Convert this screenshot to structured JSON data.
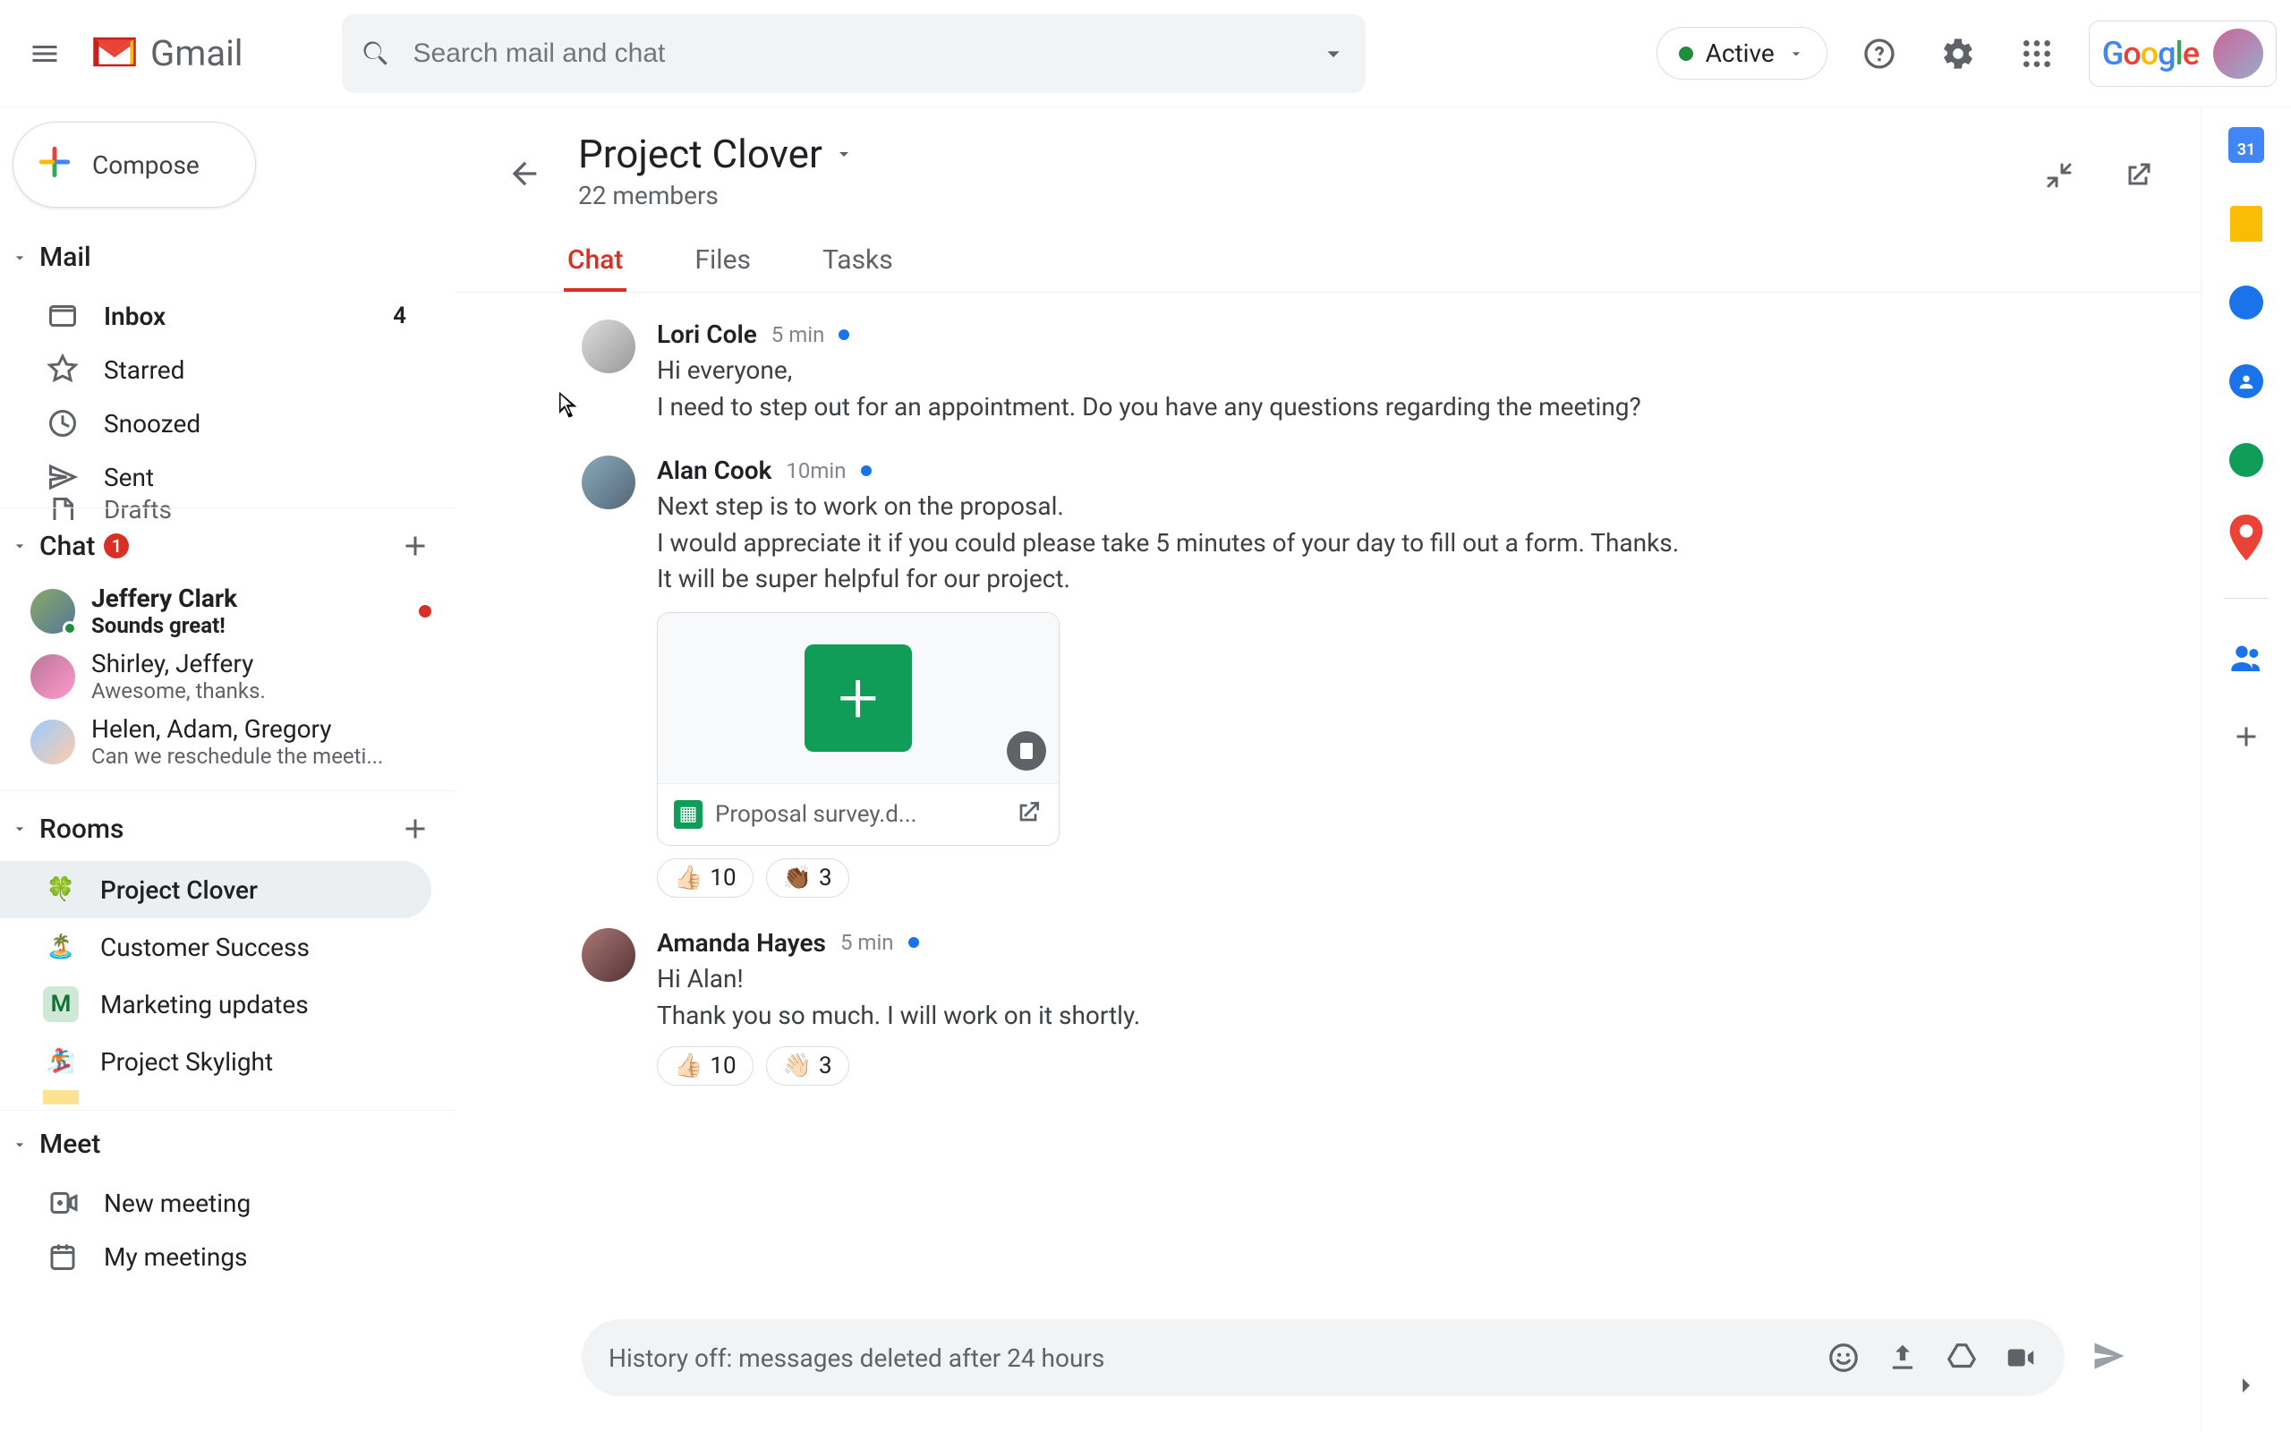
{
  "header": {
    "logo_text": "Gmail",
    "search_placeholder": "Search mail and chat",
    "status_label": "Active"
  },
  "compose_label": "Compose",
  "sections": {
    "mail_label": "Mail",
    "chat_label": "Chat",
    "chat_badge": "1",
    "rooms_label": "Rooms",
    "meet_label": "Meet"
  },
  "mail_items": [
    {
      "label": "Inbox",
      "count": "4",
      "bold": true
    },
    {
      "label": "Starred"
    },
    {
      "label": "Snoozed"
    },
    {
      "label": "Sent"
    },
    {
      "label": "Drafts"
    }
  ],
  "chat_items": [
    {
      "name": "Jeffery Clark",
      "preview": "Sounds great!",
      "bold": true,
      "unread": true,
      "presence": true
    },
    {
      "name": "Shirley, Jeffery",
      "preview": "Awesome, thanks."
    },
    {
      "name": "Helen, Adam, Gregory",
      "preview": "Can we reschedule the meeti..."
    }
  ],
  "room_items": [
    {
      "label": "Project Clover",
      "icon": "🍀",
      "active": true
    },
    {
      "label": "Customer Success",
      "icon": "🏝️"
    },
    {
      "label": "Marketing updates",
      "icon": "M",
      "color": "#ceead6",
      "fg": "#137333"
    },
    {
      "label": "Project Skylight",
      "icon": "🏂"
    }
  ],
  "meet_items": [
    {
      "label": "New meeting"
    },
    {
      "label": "My meetings"
    }
  ],
  "room": {
    "title": "Project Clover",
    "subtitle": "22 members",
    "tabs": [
      "Chat",
      "Files",
      "Tasks"
    ],
    "active_tab": 0
  },
  "messages": [
    {
      "author": "Lori Cole",
      "time": "5 min",
      "text": "Hi everyone,\nI need to step out for an appointment. Do you have any questions regarding the meeting?"
    },
    {
      "author": "Alan Cook",
      "time": "10min",
      "text": "Next step is to work on the proposal.\nI would appreciate it if you could please take 5 minutes of your day to fill out a form. Thanks.\nIt will be super helpful for our project.",
      "attachment": {
        "name": "Proposal survey.d..."
      },
      "reactions": [
        {
          "emoji": "👍🏻",
          "count": "10"
        },
        {
          "emoji": "👏🏾",
          "count": "3"
        }
      ]
    },
    {
      "author": "Amanda Hayes",
      "time": "5 min",
      "text": "Hi Alan!\nThank you so much. I will work on it shortly.",
      "reactions": [
        {
          "emoji": "👍🏻",
          "count": "10"
        },
        {
          "emoji": "👋🏻",
          "count": "3"
        }
      ]
    }
  ],
  "composer_placeholder": "History off: messages deleted after 24 hours",
  "sidepanel_cal_day": "31"
}
